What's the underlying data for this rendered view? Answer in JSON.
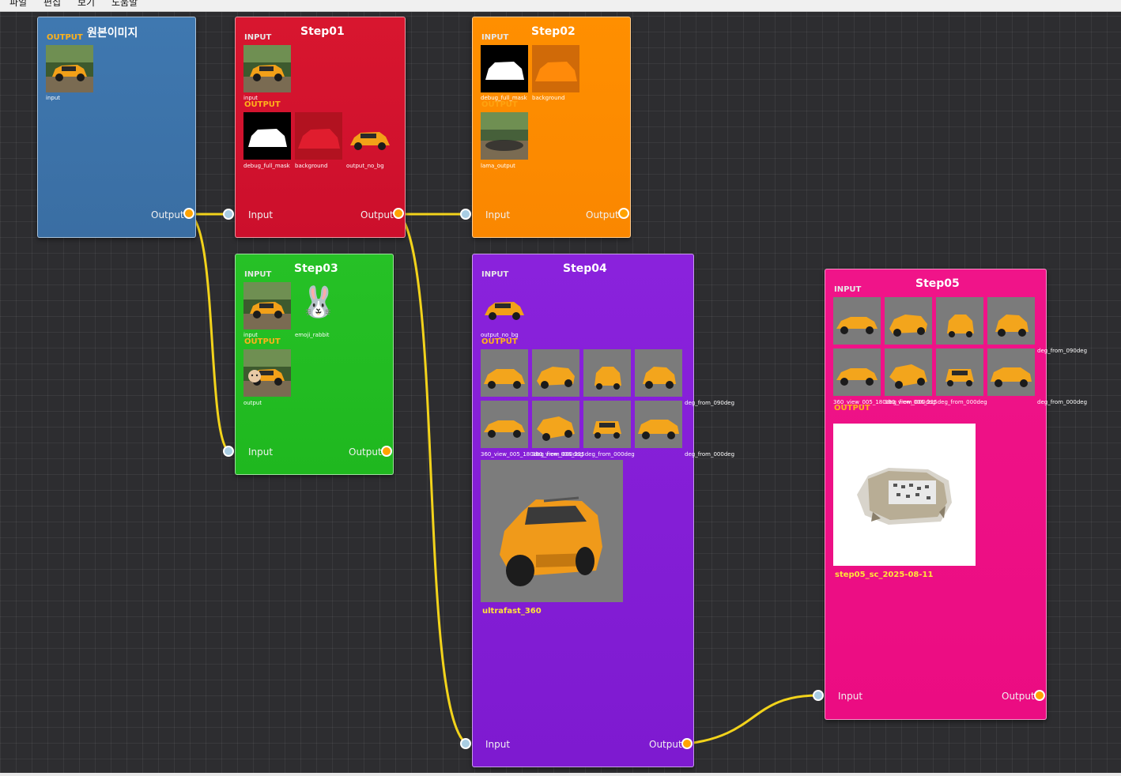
{
  "menubar": {
    "items": [
      "파일",
      "편집",
      "보기",
      "도움말"
    ]
  },
  "colors": {
    "wire": "#f2d31b",
    "port_input": "#a9cde3",
    "port_output": "#ffa300",
    "node_original": "#3d76ad",
    "node_step01": "#d3142f",
    "node_step02": "#ff8c00",
    "node_step03": "#22bd22",
    "node_step04": "#8a1fdc",
    "node_step05": "#ef0f85"
  },
  "labels": {
    "input_section": "INPUT",
    "output_section": "OUTPUT",
    "port_input": "Input",
    "port_output": "Output"
  },
  "nodes": {
    "original": {
      "title": "원본이미지",
      "outputs": [
        {
          "caption": "input",
          "icon": "car-photo"
        }
      ]
    },
    "step01": {
      "title": "Step01",
      "inputs": [
        {
          "caption": "input",
          "icon": "car-photo"
        }
      ],
      "outputs": [
        {
          "caption": "debug_full_mask",
          "icon": "mask"
        },
        {
          "caption": "background",
          "icon": "red-silhouette"
        },
        {
          "caption": "output_no_bg",
          "icon": "car-cutout"
        }
      ]
    },
    "step02": {
      "title": "Step02",
      "inputs": [
        {
          "caption": "debug_full_mask",
          "icon": "mask"
        },
        {
          "caption": "background",
          "icon": "orange-silhouette"
        }
      ],
      "outputs": [
        {
          "caption": "lama_output",
          "icon": "inpainted-background"
        }
      ]
    },
    "step03": {
      "title": "Step03",
      "inputs": [
        {
          "caption": "input",
          "icon": "car-photo"
        },
        {
          "caption": "emoji_rabbit",
          "icon": "rabbit-emoji",
          "glyph": "🐰"
        }
      ],
      "outputs": [
        {
          "caption": "output",
          "icon": "car-photo-with-rabbit"
        }
      ]
    },
    "step04": {
      "title": "Step04",
      "inputs": [
        {
          "caption": "output_no_bg",
          "icon": "car-cutout"
        }
      ],
      "output_row1_tail": "deg_from_090deg",
      "output_row2_caption": "360_view_005_180deg_from_000deg",
      "output_row2_overlap": "360_view_006_225deg_from_000deg",
      "output_row2_tail": "deg_from_000deg",
      "main_output": {
        "caption": "ultrafast_360",
        "icon": "car-3d-render"
      }
    },
    "step05": {
      "title": "Step05",
      "input_row1_tail": "deg_from_090deg",
      "input_row2_caption": "360_view_005_180deg_from_000deg",
      "input_row2_overlap": "360_view_006_225deg_from_000deg",
      "input_row2_tail": "deg_from_000deg",
      "main_output": {
        "caption": "step05_sc_2025-08-11",
        "icon": "point-cloud-render"
      }
    }
  }
}
